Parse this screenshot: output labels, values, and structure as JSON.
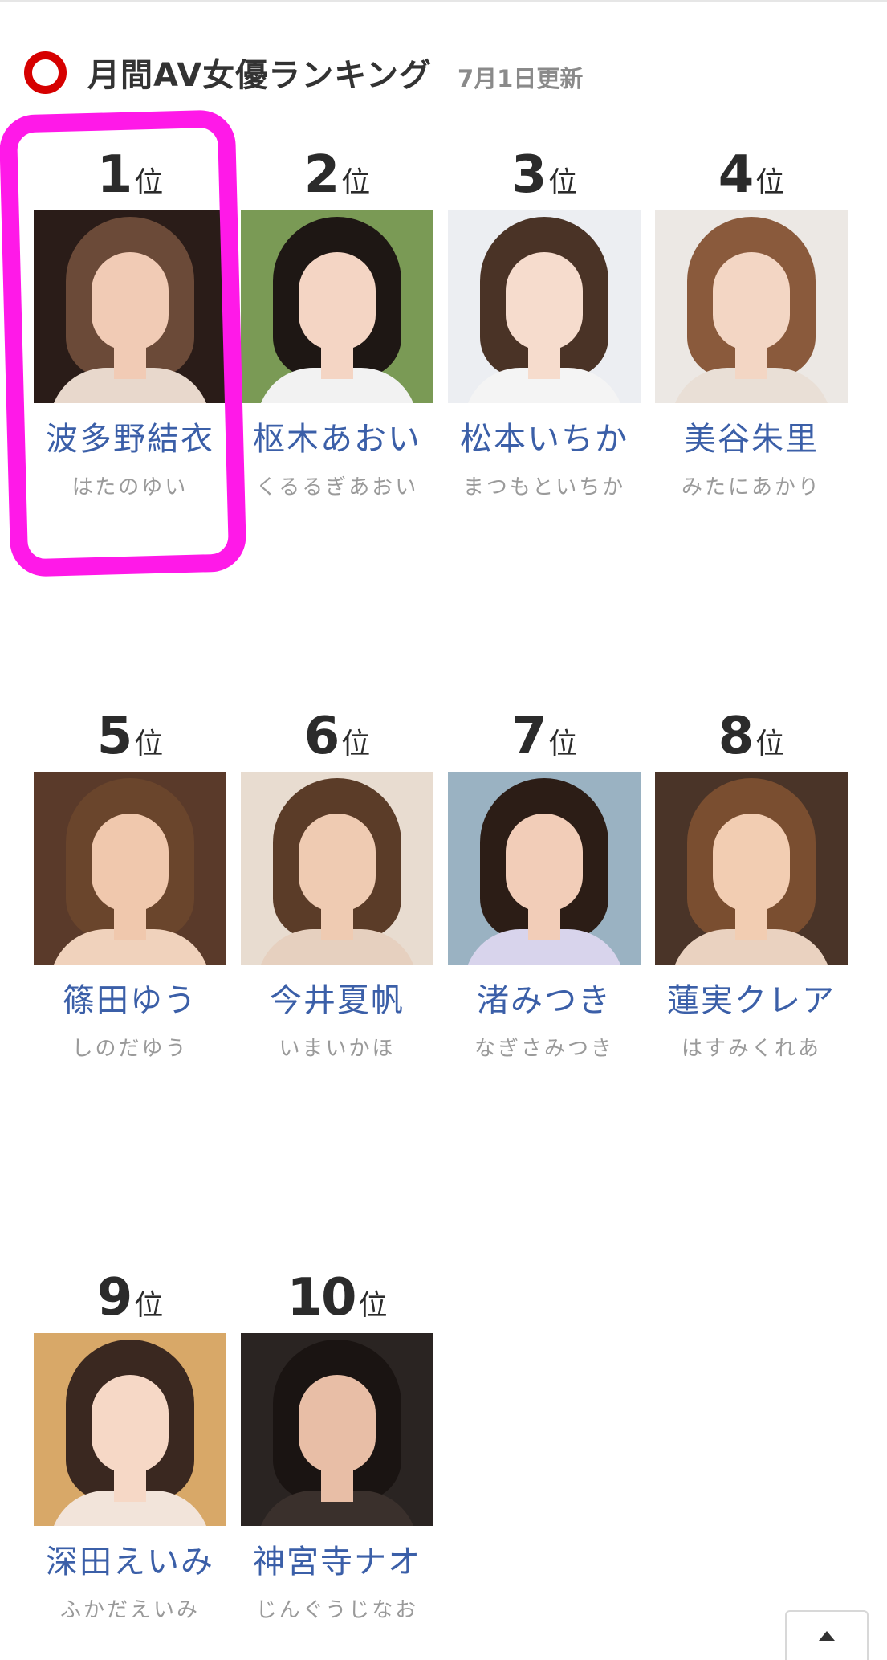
{
  "header": {
    "title": "月間AV女優ランキング",
    "updated": "7月1日更新"
  },
  "rank_suffix": "位",
  "actresses": [
    {
      "rank": "1",
      "name": "波多野結衣",
      "kana": "はたのゆい",
      "bg": "#2a1c18",
      "hair": "#6b4a38",
      "skin": "#f1cbb5",
      "top": "#e8d8cc",
      "highlighted": true
    },
    {
      "rank": "2",
      "name": "枢木あおい",
      "kana": "くるるぎあおい",
      "bg": "#7a9a55",
      "hair": "#1e1714",
      "skin": "#f4d5c4",
      "top": "#f2f2f2"
    },
    {
      "rank": "3",
      "name": "松本いちか",
      "kana": "まつもといちか",
      "bg": "#eceef2",
      "hair": "#4a3326",
      "skin": "#f6dccd",
      "top": "#f4f4f4"
    },
    {
      "rank": "4",
      "name": "美谷朱里",
      "kana": "みたにあかり",
      "bg": "#ece8e4",
      "hair": "#8a5a3c",
      "skin": "#f3d6c4",
      "top": "#e9dfd6"
    },
    {
      "rank": "5",
      "name": "篠田ゆう",
      "kana": "しのだゆう",
      "bg": "#5a3a2a",
      "hair": "#6a452c",
      "skin": "#f0c8ad",
      "top": "#f0d2bc"
    },
    {
      "rank": "6",
      "name": "今井夏帆",
      "kana": "いまいかほ",
      "bg": "#e8dcd0",
      "hair": "#5b3c28",
      "skin": "#efcbb2",
      "top": "#e6d0bf"
    },
    {
      "rank": "7",
      "name": "渚みつき",
      "kana": "なぎさみつき",
      "bg": "#9ab2c2",
      "hair": "#2c1d16",
      "skin": "#f2cdb8",
      "top": "#d8d4ec"
    },
    {
      "rank": "8",
      "name": "蓮実クレア",
      "kana": "はすみくれあ",
      "bg": "#4a3428",
      "hair": "#7a4e30",
      "skin": "#f2cdb2",
      "top": "#ead2c0"
    },
    {
      "rank": "9",
      "name": "深田えいみ",
      "kana": "ふかだえいみ",
      "bg": "#d8a868",
      "hair": "#3a2820",
      "skin": "#f6d8c6",
      "top": "#f2e4da"
    },
    {
      "rank": "10",
      "name": "神宮寺ナオ",
      "kana": "じんぐうじなお",
      "bg": "#2a2422",
      "hair": "#1a1412",
      "skin": "#e8bea6",
      "top": "#3a302c"
    }
  ]
}
